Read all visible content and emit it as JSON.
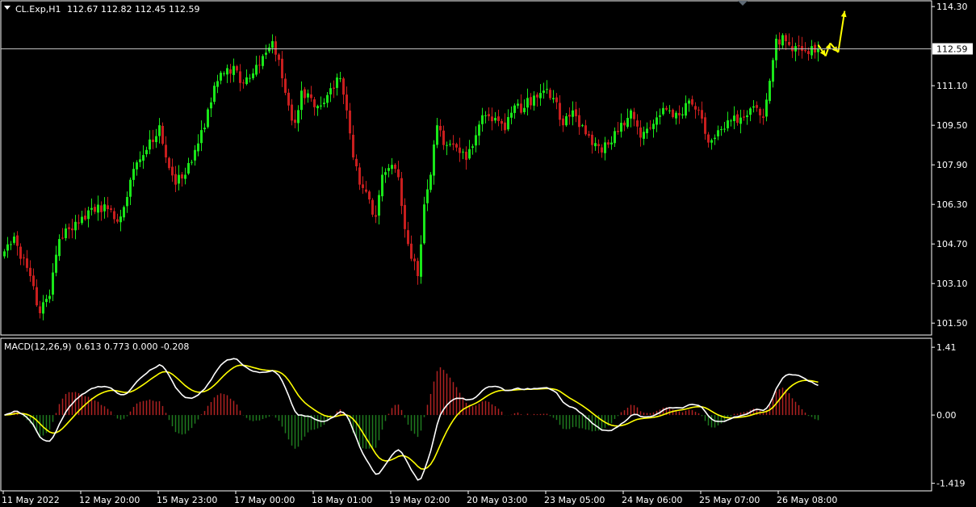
{
  "header": {
    "symbol_label": "CL.Exp,H1",
    "ohlc_text": "112.67 112.82 112.45 112.59"
  },
  "macd_header": {
    "name": "MACD(12,26,9)",
    "values_text": "0.613 0.773 0.000 -0.208"
  },
  "colors": {
    "background": "#000000",
    "bull": "#19e619",
    "bear": "#c81e1e",
    "frame": "#ffffff",
    "bid_line": "#c0c0c0",
    "arrows": "#ffff00",
    "macd_line": "#ffffff",
    "signal_line": "#ffff00",
    "hist_pos": "#b02222",
    "hist_neg": "#1e7a1e"
  },
  "current_price_label": "112.59",
  "chart_data": [
    {
      "type": "candlestick",
      "symbol": "CL.Exp",
      "timeframe": "H1",
      "y_ticks": [
        "114.30",
        "112.59",
        "111.10",
        "109.50",
        "107.90",
        "106.30",
        "104.70",
        "103.10",
        "101.50"
      ],
      "y_tick_values": [
        114.3,
        112.59,
        111.1,
        109.5,
        107.9,
        106.3,
        104.7,
        103.1,
        101.5
      ],
      "ylim": [
        101.05,
        114.5
      ],
      "current_price": 112.59,
      "x_ticks": [
        "11 May 2022",
        "12 May 20:00",
        "15 May 23:00",
        "17 May 00:00",
        "18 May 01:00",
        "19 May 02:00",
        "20 May 03:00",
        "23 May 05:00",
        "24 May 06:00",
        "25 May 07:00",
        "26 May 08:00"
      ],
      "x_tick_bars": [
        0,
        24,
        48,
        72,
        96,
        120,
        144,
        168,
        192,
        216,
        240
      ],
      "bar_count": 256,
      "anchor_closes": [
        [
          0,
          104.4
        ],
        [
          3,
          105.0
        ],
        [
          5,
          104.1
        ],
        [
          8,
          103.4
        ],
        [
          11,
          101.9
        ],
        [
          14,
          102.6
        ],
        [
          17,
          104.9
        ],
        [
          20,
          105.3
        ],
        [
          24,
          105.8
        ],
        [
          28,
          106.0
        ],
        [
          31,
          106.3
        ],
        [
          35,
          105.6
        ],
        [
          38,
          106.6
        ],
        [
          41,
          108.0
        ],
        [
          44,
          108.5
        ],
        [
          48,
          109.5
        ],
        [
          50,
          108.2
        ],
        [
          53,
          107.1
        ],
        [
          56,
          107.5
        ],
        [
          59,
          108.5
        ],
        [
          62,
          109.4
        ],
        [
          65,
          111.1
        ],
        [
          68,
          111.6
        ],
        [
          71,
          111.9
        ],
        [
          74,
          111.2
        ],
        [
          77,
          111.6
        ],
        [
          80,
          112.3
        ],
        [
          83,
          112.9
        ],
        [
          86,
          111.4
        ],
        [
          88,
          110.3
        ],
        [
          90,
          109.6
        ],
        [
          92,
          110.9
        ],
        [
          95,
          110.6
        ],
        [
          98,
          110.3
        ],
        [
          101,
          111.0
        ],
        [
          104,
          111.4
        ],
        [
          106,
          110.1
        ],
        [
          108,
          108.2
        ],
        [
          110,
          107.1
        ],
        [
          113,
          106.5
        ],
        [
          115,
          105.8
        ],
        [
          117,
          107.5
        ],
        [
          120,
          107.9
        ],
        [
          122,
          107.4
        ],
        [
          124,
          105.3
        ],
        [
          126,
          104.1
        ],
        [
          128,
          103.4
        ],
        [
          130,
          106.3
        ],
        [
          132,
          107.5
        ],
        [
          134,
          109.5
        ],
        [
          137,
          108.7
        ],
        [
          140,
          108.6
        ],
        [
          143,
          108.1
        ],
        [
          146,
          109.1
        ],
        [
          149,
          109.9
        ],
        [
          152,
          109.8
        ],
        [
          155,
          109.3
        ],
        [
          158,
          110.3
        ],
        [
          161,
          110.2
        ],
        [
          164,
          110.7
        ],
        [
          167,
          110.9
        ],
        [
          170,
          110.6
        ],
        [
          173,
          109.5
        ],
        [
          176,
          110.1
        ],
        [
          179,
          109.5
        ],
        [
          182,
          108.7
        ],
        [
          185,
          108.4
        ],
        [
          188,
          108.8
        ],
        [
          191,
          109.6
        ],
        [
          194,
          110.1
        ],
        [
          197,
          109.0
        ],
        [
          200,
          109.4
        ],
        [
          203,
          109.9
        ],
        [
          206,
          110.1
        ],
        [
          209,
          109.9
        ],
        [
          212,
          110.5
        ],
        [
          215,
          110.1
        ],
        [
          218,
          108.8
        ],
        [
          221,
          109.3
        ],
        [
          224,
          109.7
        ],
        [
          227,
          109.6
        ],
        [
          230,
          109.9
        ],
        [
          233,
          110.2
        ],
        [
          235,
          109.8
        ],
        [
          237,
          111.3
        ],
        [
          239,
          113.0
        ],
        [
          242,
          112.9
        ],
        [
          245,
          112.7
        ],
        [
          248,
          112.5
        ],
        [
          250,
          112.7
        ],
        [
          252,
          112.59
        ]
      ],
      "arrows": [
        {
          "from": [
            252.0,
            112.75
          ],
          "to": [
            254.3,
            112.3
          ]
        },
        {
          "from": [
            254.3,
            112.3
          ],
          "to": [
            255.7,
            112.82
          ]
        },
        {
          "from": [
            255.7,
            112.82
          ],
          "to": [
            258.2,
            112.45
          ]
        },
        {
          "from": [
            258.2,
            112.45
          ],
          "to": [
            260.2,
            114.12
          ]
        }
      ]
    },
    {
      "type": "macd",
      "name": "MACD(12,26,9)",
      "values": {
        "value1": 0.613,
        "value2": 0.773,
        "value3": 0.0,
        "value4": -0.208
      },
      "y_ticks": [
        "1.41",
        "0.00",
        "-1.419"
      ],
      "y_tick_values": [
        1.41,
        0.0,
        -1.419
      ],
      "ylim": [
        -1.56,
        1.58
      ]
    }
  ]
}
